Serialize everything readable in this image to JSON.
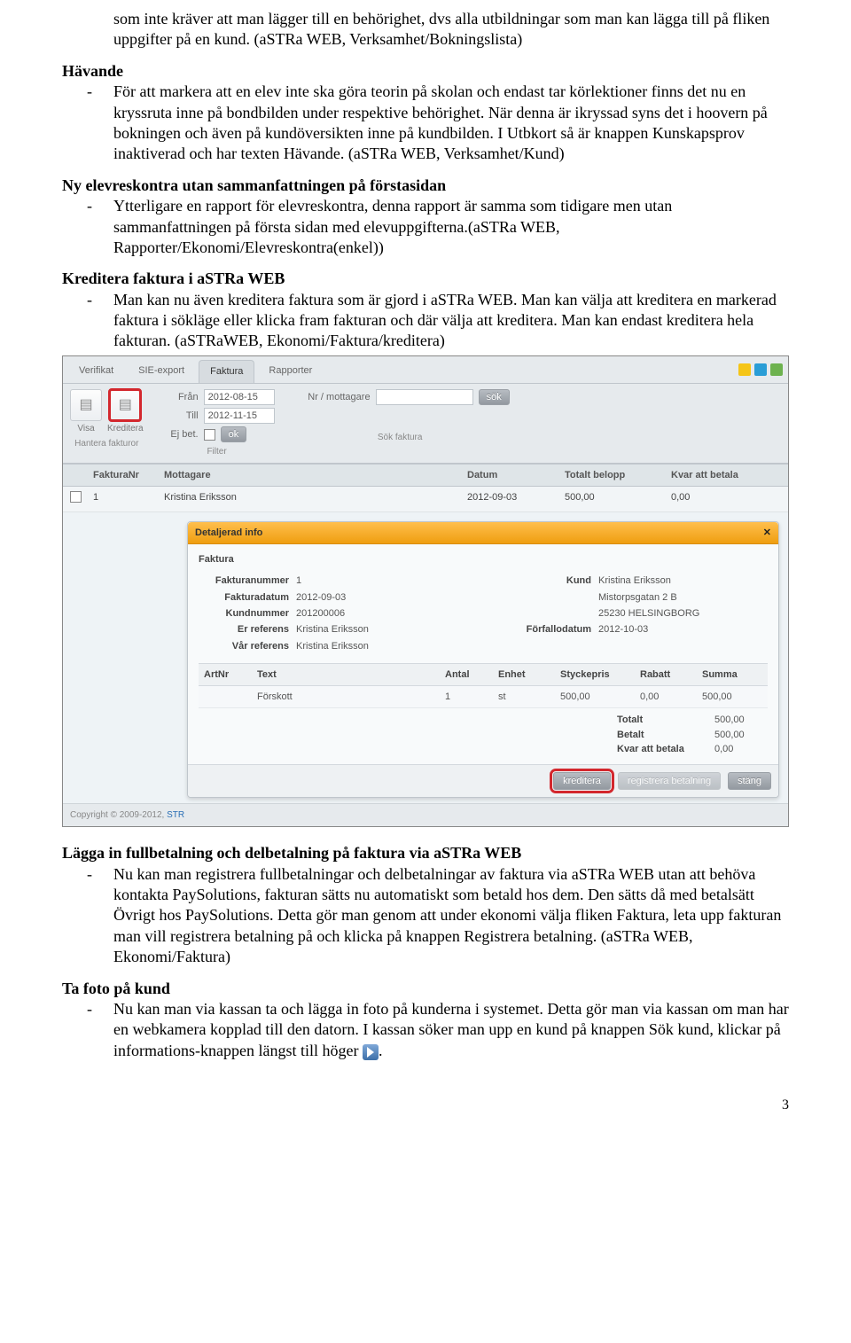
{
  "top_paragraph": "som inte kräver att man lägger till en behörighet, dvs alla utbildningar som man kan lägga till på fliken uppgifter på en kund. (aSTRa WEB, Verksamhet/Bokningslista)",
  "sections": {
    "havande": {
      "title": "Hävande",
      "item": "För att markera att en elev inte ska göra teorin på skolan och endast tar körlektioner finns det nu en kryssruta inne på bondbilden under respektive behörighet. När denna är ikryssad syns det i hoovern på bokningen och även på kundöversikten inne på kundbilden. I Utbkort så är knappen Kunskapsprov inaktiverad och har texten Hävande. (aSTRa WEB, Verksamhet/Kund)"
    },
    "elev": {
      "title": "Ny elevreskontra utan sammanfattningen på förstasidan",
      "item": "Ytterligare en rapport för elevreskontra, denna rapport är samma som tidigare men utan sammanfattningen på första sidan med elevuppgifterna.(aSTRa WEB, Rapporter/Ekonomi/Elevreskontra(enkel))"
    },
    "kred": {
      "title": "Kreditera faktura i aSTRa WEB",
      "item": "Man kan nu även kreditera faktura som är gjord i aSTRa WEB. Man kan välja att kreditera en markerad faktura i sökläge eller klicka fram fakturan och där välja att kreditera. Man kan endast kreditera hela fakturan. (aSTRaWEB, Ekonomi/Faktura/kreditera)"
    },
    "fullbet": {
      "title": "Lägga in fullbetalning och delbetalning på faktura via aSTRa WEB",
      "item": "Nu kan man registrera fullbetalningar och delbetalningar av faktura via aSTRa WEB utan att behöva kontakta PaySolutions, fakturan sätts nu automatiskt som betald hos dem. Den sätts då med betalsätt Övrigt hos PaySolutions. Detta gör man genom att under ekonomi välja fliken Faktura, leta upp fakturan man vill registrera betalning på och klicka på knappen Registrera betalning. (aSTRa WEB, Ekonomi/Faktura)"
    },
    "foto": {
      "title": "Ta foto på kund",
      "item": "Nu kan man via kassan ta och lägga in foto på kunderna i systemet. Detta gör man via kassan om man har en webkamera kopplad till den datorn. I kassan söker man upp en kund på knappen Sök kund, klickar på informations-knappen längst till höger",
      "tail": "."
    }
  },
  "ui": {
    "tabs": [
      "Verifikat",
      "SIE-export",
      "Faktura",
      "Rapporter"
    ],
    "active_tab": "Faktura",
    "toolbar": {
      "visa": "Visa",
      "kreditera": "Kreditera",
      "group1": "Hantera fakturor",
      "from_lbl": "Från",
      "from_val": "2012-08-15",
      "till_lbl": "Till",
      "till_val": "2012-11-15",
      "ejbet_lbl": "Ej bet.",
      "ok": "ok",
      "filter_lbl": "Filter",
      "nrmot_lbl": "Nr / mottagare",
      "sok": "sök",
      "sokfaktura_lbl": "Sök faktura"
    },
    "cols": {
      "fnr": "FakturaNr",
      "mot": "Mottagare",
      "dat": "Datum",
      "tot": "Totalt belopp",
      "kvar": "Kvar att betala"
    },
    "row": {
      "nr": "1",
      "mot": "Kristina Eriksson",
      "dat": "2012-09-03",
      "tot": "500,00",
      "kvar": "0,00"
    },
    "detail": {
      "title": "Detaljerad info",
      "section": "Faktura",
      "left": {
        "fnr_l": "Fakturanummer",
        "fnr_v": "1",
        "fdat_l": "Fakturadatum",
        "fdat_v": "2012-09-03",
        "knr_l": "Kundnummer",
        "knr_v": "201200006",
        "eref_l": "Er referens",
        "eref_v": "Kristina Eriksson",
        "vref_l": "Vår referens",
        "vref_v": "Kristina Eriksson"
      },
      "right": {
        "kund_l": "Kund",
        "kund_v": "Kristina Eriksson",
        "addr1": "Mistorpsgatan 2 B",
        "addr2": "25230 HELSINGBORG",
        "forf_l": "Förfallodatum",
        "forf_v": "2012-10-03"
      },
      "arth": {
        "nr": "ArtNr",
        "txt": "Text",
        "ant": "Antal",
        "enh": "Enhet",
        "sty": "Styckepris",
        "rab": "Rabatt",
        "sum": "Summa"
      },
      "art": {
        "txt": "Förskott",
        "ant": "1",
        "enh": "st",
        "sty": "500,00",
        "rab": "0,00",
        "sum": "500,00"
      },
      "tot": {
        "t_l": "Totalt",
        "t_v": "500,00",
        "b_l": "Betalt",
        "b_v": "500,00",
        "k_l": "Kvar att betala",
        "k_v": "0,00"
      },
      "btns": {
        "kred": "kreditera",
        "reg": "registrera betalning",
        "stang": "stäng"
      }
    },
    "copyright": "Copyright © 2009-2012, ",
    "copyright_link": "STR"
  },
  "page_num": "3"
}
